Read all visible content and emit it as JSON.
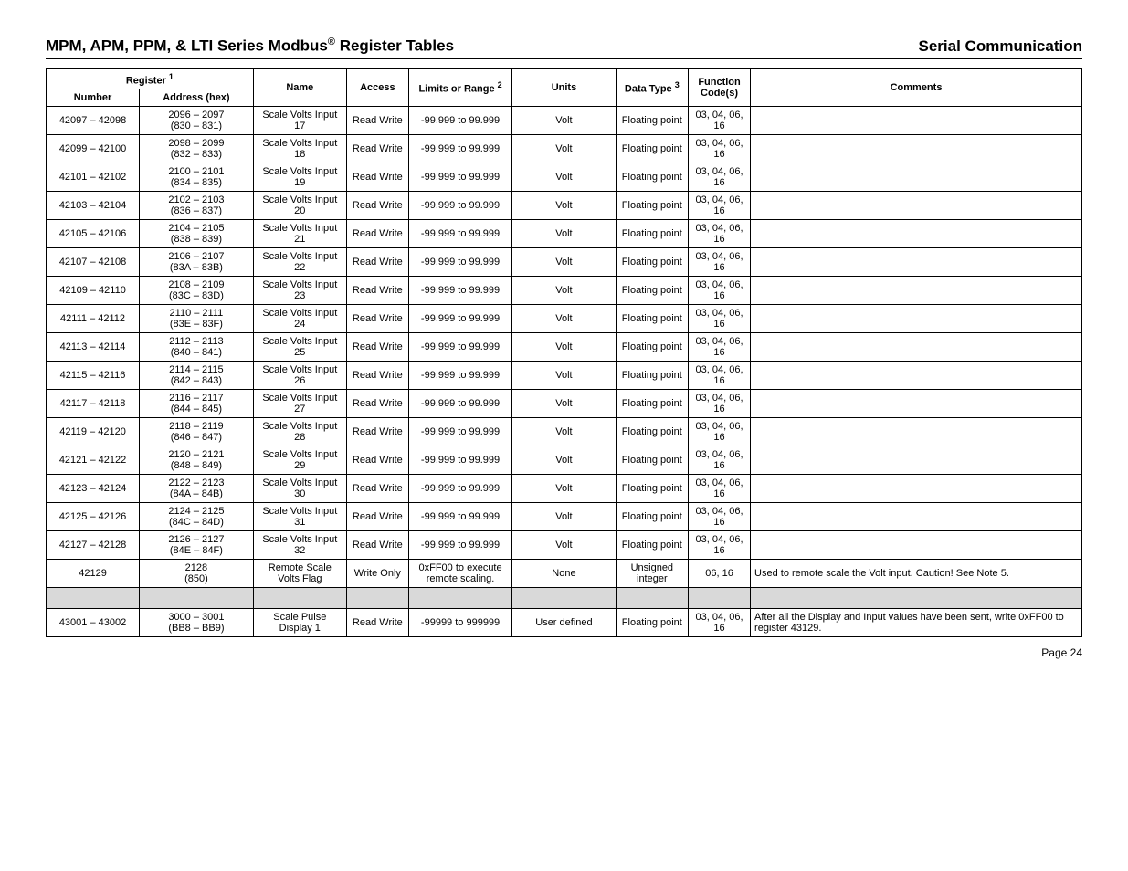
{
  "header": {
    "title_left_a": "MPM, APM, PPM, & LTI Series Modbus",
    "title_left_sup": "®",
    "title_left_b": " Register Tables",
    "title_right": "Serial Communication"
  },
  "columns": {
    "register": "Register",
    "register_sup": "1",
    "number": "Number",
    "address": "Address (hex)",
    "name": "Name",
    "access": "Access",
    "limits": "Limits or Range",
    "limits_sup": "2",
    "units": "Units",
    "data": "Data Type",
    "data_sup": "3",
    "func": "Function Code(s)",
    "comments": "Comments"
  },
  "rows": [
    {
      "num": "42097 – 42098",
      "addr": "2096 – 2097\n(830 – 831)",
      "name": "Scale Volts Input 17",
      "access": "Read Write",
      "limits": "-99.999 to 99.999",
      "units": "Volt",
      "type": "Floating point",
      "func": "03, 04, 06, 16",
      "comm": ""
    },
    {
      "num": "42099 – 42100",
      "addr": "2098 – 2099\n(832 – 833)",
      "name": "Scale Volts Input 18",
      "access": "Read Write",
      "limits": "-99.999 to 99.999",
      "units": "Volt",
      "type": "Floating point",
      "func": "03, 04, 06, 16",
      "comm": ""
    },
    {
      "num": "42101 – 42102",
      "addr": "2100 – 2101\n(834 – 835)",
      "name": "Scale Volts Input 19",
      "access": "Read Write",
      "limits": "-99.999 to 99.999",
      "units": "Volt",
      "type": "Floating point",
      "func": "03, 04, 06, 16",
      "comm": ""
    },
    {
      "num": "42103 – 42104",
      "addr": "2102 – 2103\n(836 – 837)",
      "name": "Scale Volts Input 20",
      "access": "Read Write",
      "limits": "-99.999 to 99.999",
      "units": "Volt",
      "type": "Floating point",
      "func": "03, 04, 06, 16",
      "comm": ""
    },
    {
      "num": "42105 – 42106",
      "addr": "2104 – 2105\n(838 – 839)",
      "name": "Scale Volts Input 21",
      "access": "Read Write",
      "limits": "-99.999 to 99.999",
      "units": "Volt",
      "type": "Floating point",
      "func": "03, 04, 06, 16",
      "comm": ""
    },
    {
      "num": "42107 – 42108",
      "addr": "2106 – 2107\n(83A – 83B)",
      "name": "Scale Volts Input 22",
      "access": "Read Write",
      "limits": "-99.999 to 99.999",
      "units": "Volt",
      "type": "Floating point",
      "func": "03, 04, 06, 16",
      "comm": ""
    },
    {
      "num": "42109 – 42110",
      "addr": "2108 – 2109\n(83C – 83D)",
      "name": "Scale Volts Input 23",
      "access": "Read Write",
      "limits": "-99.999 to 99.999",
      "units": "Volt",
      "type": "Floating point",
      "func": "03, 04, 06, 16",
      "comm": ""
    },
    {
      "num": "42111 – 42112",
      "addr": "2110 – 2111\n(83E – 83F)",
      "name": "Scale Volts Input 24",
      "access": "Read Write",
      "limits": "-99.999 to 99.999",
      "units": "Volt",
      "type": "Floating point",
      "func": "03, 04, 06, 16",
      "comm": ""
    },
    {
      "num": "42113 – 42114",
      "addr": "2112 – 2113\n(840 – 841)",
      "name": "Scale Volts Input 25",
      "access": "Read Write",
      "limits": "-99.999 to 99.999",
      "units": "Volt",
      "type": "Floating point",
      "func": "03, 04, 06, 16",
      "comm": ""
    },
    {
      "num": "42115 – 42116",
      "addr": "2114 – 2115\n(842 – 843)",
      "name": "Scale Volts Input 26",
      "access": "Read Write",
      "limits": "-99.999 to 99.999",
      "units": "Volt",
      "type": "Floating point",
      "func": "03, 04, 06, 16",
      "comm": ""
    },
    {
      "num": "42117 – 42118",
      "addr": "2116 – 2117\n(844 – 845)",
      "name": "Scale Volts Input 27",
      "access": "Read Write",
      "limits": "-99.999 to 99.999",
      "units": "Volt",
      "type": "Floating point",
      "func": "03, 04, 06, 16",
      "comm": ""
    },
    {
      "num": "42119 – 42120",
      "addr": "2118 – 2119\n(846 – 847)",
      "name": "Scale Volts Input 28",
      "access": "Read Write",
      "limits": "-99.999 to 99.999",
      "units": "Volt",
      "type": "Floating point",
      "func": "03, 04, 06, 16",
      "comm": ""
    },
    {
      "num": "42121 – 42122",
      "addr": "2120 – 2121\n(848 – 849)",
      "name": "Scale Volts Input 29",
      "access": "Read Write",
      "limits": "-99.999 to 99.999",
      "units": "Volt",
      "type": "Floating point",
      "func": "03, 04, 06, 16",
      "comm": ""
    },
    {
      "num": "42123 – 42124",
      "addr": "2122 – 2123\n(84A – 84B)",
      "name": "Scale Volts Input 30",
      "access": "Read Write",
      "limits": "-99.999 to 99.999",
      "units": "Volt",
      "type": "Floating point",
      "func": "03, 04, 06, 16",
      "comm": ""
    },
    {
      "num": "42125 – 42126",
      "addr": "2124 – 2125\n(84C – 84D)",
      "name": "Scale Volts Input 31",
      "access": "Read Write",
      "limits": "-99.999 to 99.999",
      "units": "Volt",
      "type": "Floating point",
      "func": "03, 04, 06, 16",
      "comm": ""
    },
    {
      "num": "42127 – 42128",
      "addr": "2126 – 2127\n(84E – 84F)",
      "name": "Scale Volts Input 32",
      "access": "Read Write",
      "limits": "-99.999 to 99.999",
      "units": "Volt",
      "type": "Floating point",
      "func": "03, 04, 06, 16",
      "comm": ""
    },
    {
      "num": "42129",
      "addr": "2128\n(850)",
      "name": "Remote Scale Volts Flag",
      "access": "Write Only",
      "limits": "0xFF00 to execute remote scaling.",
      "units": "None",
      "type": "Unsigned integer",
      "func": "06, 16",
      "comm": "Used to remote scale the Volt input. Caution! See Note 5."
    }
  ],
  "rows2": [
    {
      "num": "43001 – 43002",
      "addr": "3000 – 3001\n(BB8 – BB9)",
      "name": "Scale Pulse Display 1",
      "access": "Read Write",
      "limits": "-99999 to 999999",
      "units": "User defined",
      "type": "Floating point",
      "func": "03, 04, 06, 16",
      "comm": "After all the Display and Input values have been sent, write 0xFF00 to register 43129."
    }
  ],
  "footer": {
    "page": "Page 24"
  }
}
